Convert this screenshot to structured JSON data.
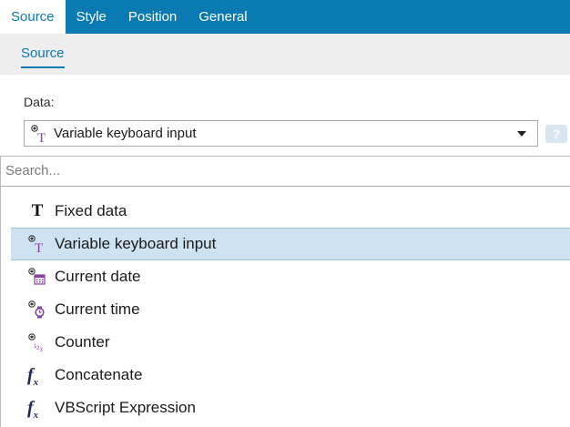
{
  "tabs": [
    {
      "label": "Source",
      "active": true
    },
    {
      "label": "Style",
      "active": false
    },
    {
      "label": "Position",
      "active": false
    },
    {
      "label": "General",
      "active": false
    }
  ],
  "subtab": {
    "label": "Source"
  },
  "data_field": {
    "label": "Data:",
    "selected_value": "Variable keyboard input",
    "selected_icon": "variable-text-icon",
    "help_icon": "help-icon"
  },
  "search": {
    "placeholder": "Search...",
    "value": ""
  },
  "options": [
    {
      "label": "Fixed data",
      "icon": "fixed-text-icon",
      "selected": false
    },
    {
      "label": "Variable keyboard input",
      "icon": "variable-text-icon",
      "selected": true
    },
    {
      "label": "Current date",
      "icon": "calendar-icon",
      "selected": false
    },
    {
      "label": "Current time",
      "icon": "watch-icon",
      "selected": false
    },
    {
      "label": "Counter",
      "icon": "counter-icon",
      "selected": false
    },
    {
      "label": "Concatenate",
      "icon": "function-icon",
      "selected": false
    },
    {
      "label": "VBScript Expression",
      "icon": "function-icon",
      "selected": false
    }
  ],
  "colors": {
    "accent": "#0a7ab3",
    "selection": "#cde3f1",
    "icon_purple": "#8b3fa6"
  }
}
